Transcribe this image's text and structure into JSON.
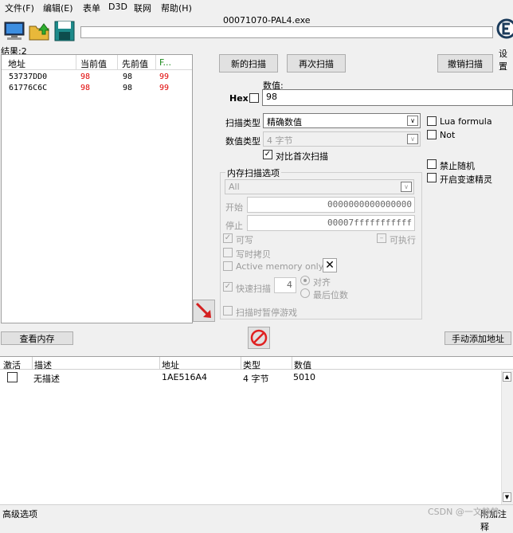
{
  "menu": {
    "file": "文件(F)",
    "edit": "编辑(E)",
    "table": "表单",
    "d3d": "D3D",
    "network": "联网",
    "help": "帮助(H)"
  },
  "window": {
    "title": "00071070-PAL4.exe"
  },
  "toolbar": {
    "settings_label": "设置"
  },
  "results": {
    "count_label": "结果:2",
    "columns": [
      "地址",
      "当前值",
      "先前值",
      "F..."
    ],
    "rows": [
      {
        "address": "53737DD0",
        "current": "98",
        "previous": "98",
        "first": "99"
      },
      {
        "address": "61776C6C",
        "current": "98",
        "previous": "98",
        "first": "99"
      }
    ]
  },
  "scan": {
    "new_scan": "新的扫描",
    "next_scan": "再次扫描",
    "undo_scan": "撤销扫描",
    "value_label": "数值:",
    "hex_label": "Hex",
    "value": "98",
    "scan_type_label": "扫描类型",
    "scan_type_value": "精确数值",
    "value_type_label": "数值类型",
    "value_type_value": "4 字节",
    "compare_first": "对比首次扫描",
    "lua_formula": "Lua formula",
    "not": "Not",
    "no_random": "禁止随机",
    "speedhack": "开启变速精灵"
  },
  "memory_options": {
    "title": "内存扫描选项",
    "region": "All",
    "start_label": "开始",
    "start_value": "0000000000000000",
    "stop_label": "停止",
    "stop_value": "00007fffffffffff",
    "writable": "可写",
    "executable": "可执行",
    "copy_on_write": "写时拷贝",
    "active_memory": "Active memory only",
    "fast_scan": "快速扫描",
    "fast_scan_value": "4",
    "align": "对齐",
    "last_digits": "最后位数",
    "pause_game": "扫描时暂停游戏"
  },
  "actions": {
    "view_memory": "查看内存",
    "add_address": "手动添加地址"
  },
  "address_list": {
    "columns": [
      "激活",
      "描述",
      "地址",
      "类型",
      "数值"
    ],
    "rows": [
      {
        "description": "无描述",
        "address": "1AE516A4",
        "type": "4 字节",
        "value": "5010"
      }
    ]
  },
  "status": {
    "advanced": "高级选项",
    "attach": "附加注释",
    "watermark": "CSDN @一文静静"
  },
  "colors": {
    "accent_red": "#e00000",
    "arrow_red": "#d42020"
  },
  "icons": [
    "computer-icon",
    "open-folder-icon",
    "save-disk-icon",
    "cheat-engine-logo-icon",
    "arrow-icon",
    "stop-icon",
    "close-x-icon"
  ]
}
